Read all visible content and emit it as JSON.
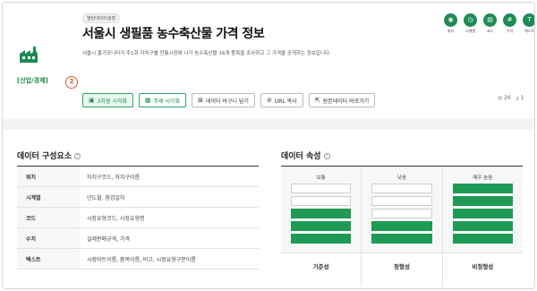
{
  "header": {
    "tag": "열린데이터광장",
    "title": "서울시 생필품 농수축산물 가격 정보",
    "description": "서울시 물가모니터가 주1회 자치구별 전통시장에 나가 농수축산물 16개 품목을 조사하고 그 가격을 공개하는 정보입니다.",
    "category_label": "[산업/경제]",
    "step_badge": "2"
  },
  "actions": [
    {
      "label": "3차원 시각화",
      "icon": "cube-icon"
    },
    {
      "label": "주제 시각화",
      "icon": "chart-icon"
    },
    {
      "label": "데이터 바구니 담기",
      "icon": "basket-icon"
    },
    {
      "label": "URL 복사",
      "icon": "link-icon"
    },
    {
      "label": "원본데이터 바로가기",
      "icon": "external-icon"
    }
  ],
  "top_icons": [
    {
      "label": "위치",
      "icon": "location-icon"
    },
    {
      "label": "시계열",
      "icon": "clock-icon"
    },
    {
      "label": "코드",
      "icon": "code-icon"
    },
    {
      "label": "수치",
      "icon": "number-icon"
    },
    {
      "label": "텍스트",
      "icon": "text-icon"
    }
  ],
  "stats": {
    "views": "26",
    "downloads": "1"
  },
  "components": {
    "title": "데이터 구성요소",
    "rows": [
      {
        "key": "위치",
        "value": "자치구코드, 자치구이름"
      },
      {
        "key": "시계열",
        "value": "년도월, 점검일자"
      },
      {
        "key": "코드",
        "value": "시장유형코드, 시장유형명"
      },
      {
        "key": "수치",
        "value": "실제판매규격, 가격"
      },
      {
        "key": "텍스트",
        "value": "시장마트이름, 품목이름, 비고, 시장유형구분이름"
      }
    ]
  },
  "attributes": {
    "title": "데이터 속성",
    "columns": [
      {
        "level": "보통",
        "filled": 3,
        "total": 5,
        "label": "기준성"
      },
      {
        "level": "낮음",
        "filled": 2,
        "total": 5,
        "label": "정형성"
      },
      {
        "level": "매우 높음",
        "filled": 5,
        "total": 5,
        "label": "비정형성"
      }
    ]
  }
}
